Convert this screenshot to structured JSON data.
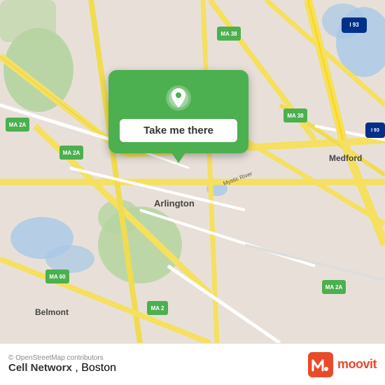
{
  "map": {
    "background_color": "#e8e0d8",
    "region": "Arlington, Boston area",
    "attribution": "© OpenStreetMap contributors"
  },
  "popup": {
    "button_label": "Take me there",
    "background_color": "#4caf50"
  },
  "labels": {
    "ma2a_left": "MA 2A",
    "ma2a_center": "MA 2A",
    "ma38_top": "MA 38",
    "ma38_right": "MA 38",
    "ma2": "MA 2",
    "ma60": "MA 60",
    "ma2a_bottom": "MA 2A",
    "i93_top": "I 93",
    "i93_right": "I 93",
    "arlington": "Arlington",
    "medford": "Medford",
    "belmont": "Belmont"
  },
  "bottom_bar": {
    "app_name": "Cell Networx",
    "city": "Boston",
    "attribution": "© OpenStreetMap contributors",
    "logo_text": "moovit"
  }
}
